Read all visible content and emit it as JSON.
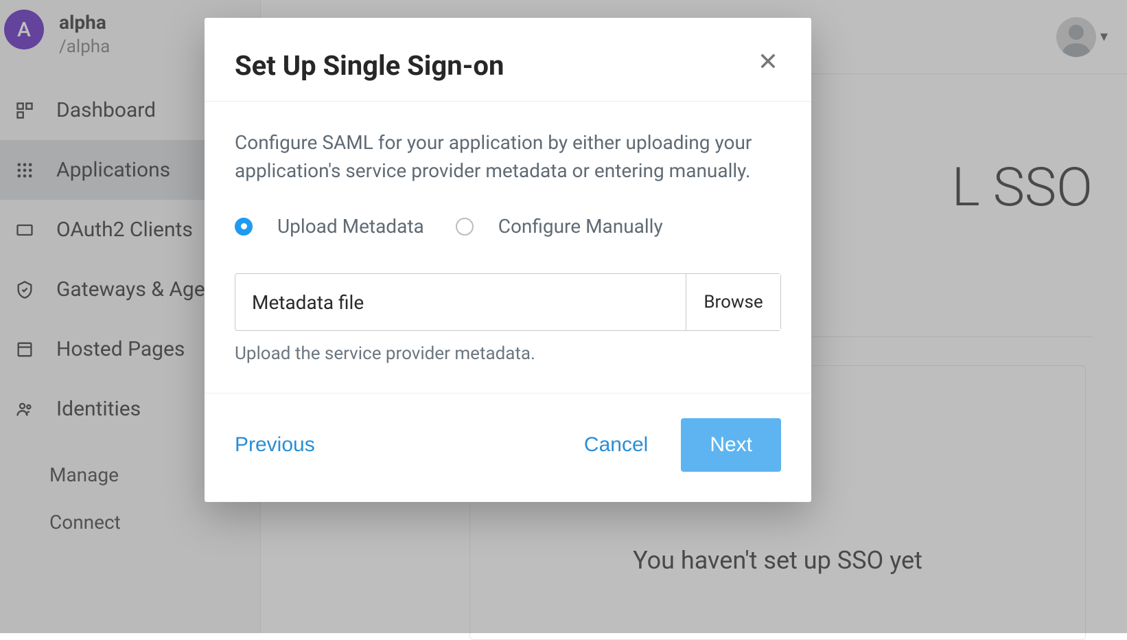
{
  "org": {
    "initial": "A",
    "name": "alpha",
    "slug": "/alpha"
  },
  "sidebar": {
    "items": [
      {
        "label": "Dashboard",
        "icon": "dashboard-icon",
        "active": false
      },
      {
        "label": "Applications",
        "icon": "applications-icon",
        "active": true
      },
      {
        "label": "OAuth2 Clients",
        "icon": "oauth-icon",
        "active": false
      },
      {
        "label": "Gateways & Agents",
        "icon": "shield-icon",
        "active": false
      },
      {
        "label": "Hosted Pages",
        "icon": "pages-icon",
        "active": false
      },
      {
        "label": "Identities",
        "icon": "identities-icon",
        "active": false
      }
    ],
    "sub_items": [
      {
        "label": "Manage"
      },
      {
        "label": "Connect"
      }
    ]
  },
  "background": {
    "title_fragment": "L SSO",
    "card_text": "You haven't set up SSO yet"
  },
  "modal": {
    "title": "Set Up Single Sign-on",
    "description": "Configure SAML for your application by either uploading your application's service provider metadata or entering manually.",
    "radios": {
      "upload_label": "Upload Metadata",
      "manual_label": "Configure Manually",
      "selected": "upload"
    },
    "file_input": {
      "label": "Metadata file",
      "browse": "Browse",
      "help": "Upload the service provider metadata."
    },
    "buttons": {
      "previous": "Previous",
      "cancel": "Cancel",
      "next": "Next"
    }
  }
}
